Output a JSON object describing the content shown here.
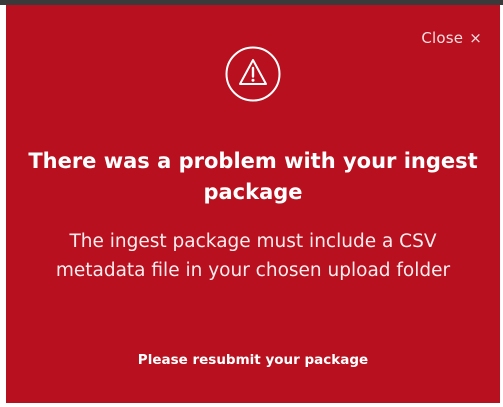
{
  "colors": {
    "modal_background": "#b8101e",
    "text": "#ffffff",
    "top_bar": "#3a3a3a"
  },
  "dialog": {
    "close_label": "Close",
    "close_icon": "close-icon",
    "alert_icon": "warning-triangle-icon",
    "title": "There was a problem with your ingest package",
    "message": "The ingest package must include a CSV metadata file in your chosen upload folder",
    "footer_note": "Please resubmit your package"
  }
}
